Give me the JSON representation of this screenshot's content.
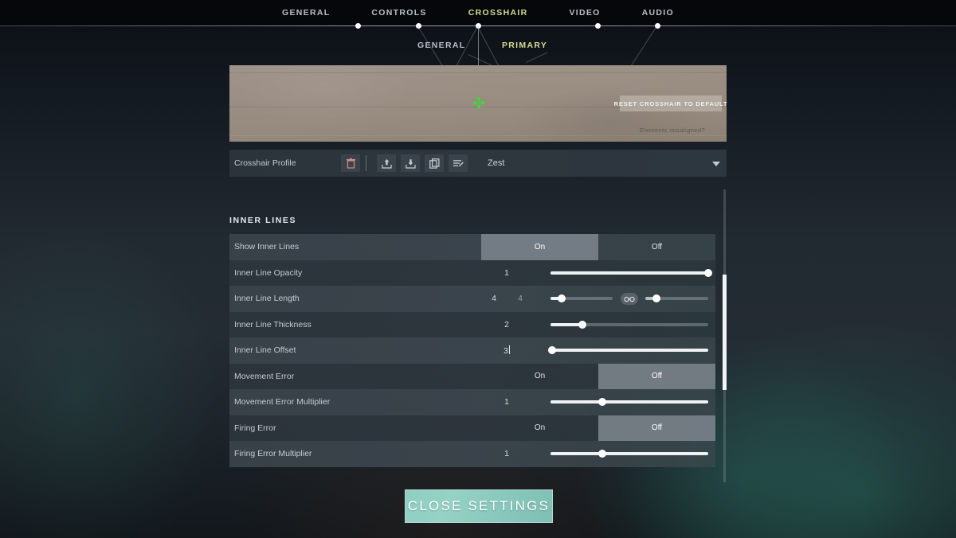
{
  "nav": {
    "items": [
      {
        "label": "GENERAL",
        "active": false
      },
      {
        "label": "CONTROLS",
        "active": false
      },
      {
        "label": "CROSSHAIR",
        "active": true
      },
      {
        "label": "VIDEO",
        "active": false
      },
      {
        "label": "AUDIO",
        "active": false
      }
    ],
    "subitems": [
      {
        "label": "GENERAL",
        "active": false
      },
      {
        "label": "PRIMARY",
        "active": true
      }
    ]
  },
  "preview": {
    "reset_label": "RESET CROSSHAIR TO DEFAULT",
    "misaligned_label": "Elements misaligned?",
    "crosshair_color": "#2de82d",
    "wall_color": "#9b8f84"
  },
  "profile": {
    "label": "Crosshair Profile",
    "selected": "Zest",
    "icons": [
      {
        "name": "delete-icon",
        "color": "#d98a8a"
      },
      {
        "name": "upload-icon",
        "color": "#c8ced4"
      },
      {
        "name": "download-icon",
        "color": "#c8ced4"
      },
      {
        "name": "copy-icon",
        "color": "#c8ced4"
      },
      {
        "name": "rename-icon",
        "color": "#c8ced4"
      }
    ]
  },
  "settings": {
    "section_title": "INNER LINES",
    "toggle_on": "On",
    "toggle_off": "Off",
    "rows": [
      {
        "label": "Show Inner Lines",
        "kind": "toggle",
        "value": "On"
      },
      {
        "label": "Inner Line Opacity",
        "kind": "slider",
        "value": "1",
        "pct": 100
      },
      {
        "label": "Inner Line Length",
        "kind": "dual",
        "value": "4",
        "value2": "4",
        "pct": 18,
        "pct2": 18
      },
      {
        "label": "Inner Line Thickness",
        "kind": "slider",
        "value": "2",
        "pct": 20
      },
      {
        "label": "Inner Line Offset",
        "kind": "slider",
        "value": "3",
        "pct": 1,
        "editing": true
      },
      {
        "label": "Movement Error",
        "kind": "toggle",
        "value": "Off"
      },
      {
        "label": "Movement Error Multiplier",
        "kind": "slider",
        "value": "1",
        "pct": 33
      },
      {
        "label": "Firing Error",
        "kind": "toggle",
        "value": "Off"
      },
      {
        "label": "Firing Error Multiplier",
        "kind": "slider",
        "value": "1",
        "pct": 33
      }
    ]
  },
  "footer": {
    "close_label": "CLOSE SETTINGS"
  },
  "colors": {
    "accent_yellow": "#d4dd90",
    "close_button": "#8fcec2",
    "toggle_selected": "#788089",
    "panel_row_light": "#3a424a",
    "panel_row_dark": "#2c343c"
  },
  "scrollbar": {
    "thumb_top_pct": 29,
    "thumb_height_pct": 39
  }
}
